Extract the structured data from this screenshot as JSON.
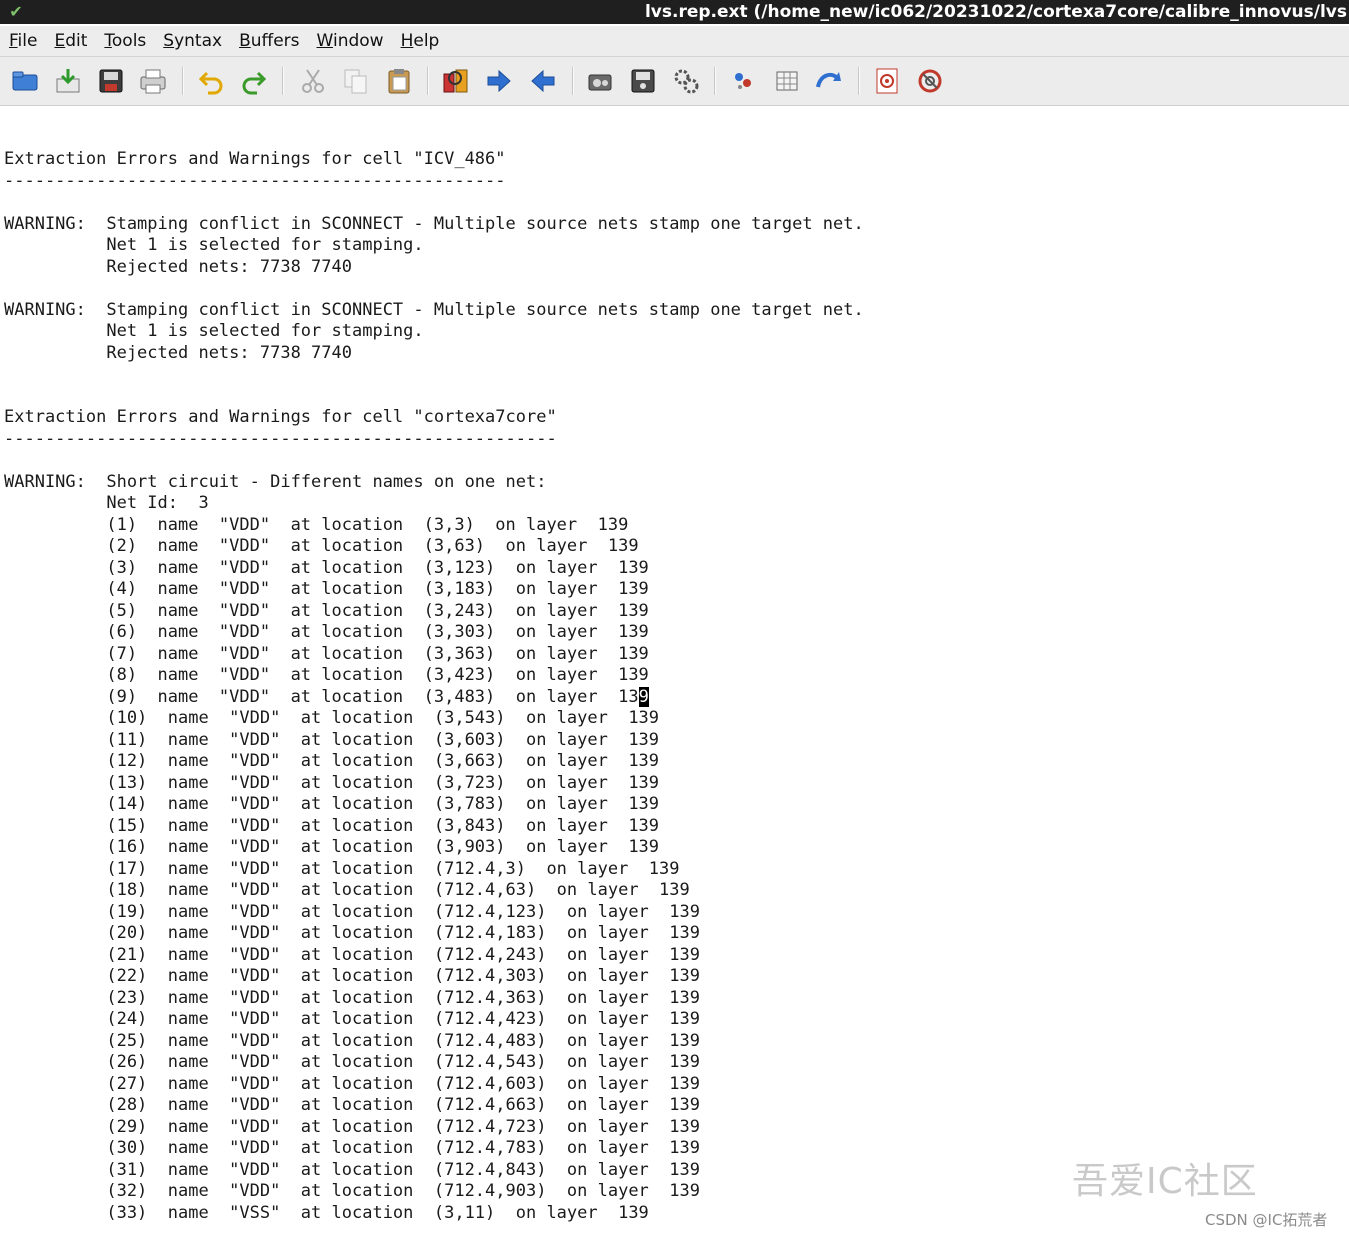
{
  "window": {
    "title": "lvs.rep.ext (/home_new/ic062/20231022/cortexa7core/calibre_innovus/lvs",
    "icon": "vim-icon"
  },
  "menu": [
    "File",
    "Edit",
    "Tools",
    "Syntax",
    "Buffers",
    "Window",
    "Help"
  ],
  "toolbar": {
    "icons": [
      "open-icon",
      "save-icon",
      "save-all-icon",
      "print-icon",
      "undo-icon",
      "redo-icon",
      "cut-icon",
      "copy-icon",
      "paste-icon",
      "find-replace-icon",
      "find-next-icon",
      "find-prev-icon",
      "load-session-icon",
      "save-session-icon",
      "run-script-icon",
      "make-icon",
      "shell-icon",
      "ctags-jump-icon",
      "help-icon",
      "find-help-icon"
    ],
    "accent_blue": "#2f6fd0",
    "accent_green": "#3a9a2a",
    "accent_yellow": "#e6b400",
    "accent_red": "#c0392b"
  },
  "editor": {
    "cursor": {
      "line": 27,
      "col": 16
    },
    "lines": [
      "",
      "",
      "Extraction Errors and Warnings for cell \"ICV_486\"",
      "-------------------------------------------------",
      "",
      "WARNING:  Stamping conflict in SCONNECT - Multiple source nets stamp one target net.",
      "          Net 1 is selected for stamping.",
      "          Rejected nets: 7738 7740",
      "",
      "WARNING:  Stamping conflict in SCONNECT - Multiple source nets stamp one target net.",
      "          Net 1 is selected for stamping.",
      "          Rejected nets: 7738 7740",
      "",
      "",
      "Extraction Errors and Warnings for cell \"cortexa7core\"",
      "------------------------------------------------------",
      "",
      "WARNING:  Short circuit - Different names on one net:",
      "          Net Id:  3",
      "          (1)  name  \"VDD\"  at location  (3,3)  on layer  139",
      "          (2)  name  \"VDD\"  at location  (3,63)  on layer  139",
      "          (3)  name  \"VDD\"  at location  (3,123)  on layer  139",
      "          (4)  name  \"VDD\"  at location  (3,183)  on layer  139",
      "          (5)  name  \"VDD\"  at location  (3,243)  on layer  139",
      "          (6)  name  \"VDD\"  at location  (3,303)  on layer  139",
      "          (7)  name  \"VDD\"  at location  (3,363)  on layer  139",
      "          (8)  name  \"VDD\"  at location  (3,423)  on layer  139",
      "          (9)  name  \"VDD\"  at location  (3,483)  on layer  139",
      "          (10)  name  \"VDD\"  at location  (3,543)  on layer  139",
      "          (11)  name  \"VDD\"  at location  (3,603)  on layer  139",
      "          (12)  name  \"VDD\"  at location  (3,663)  on layer  139",
      "          (13)  name  \"VDD\"  at location  (3,723)  on layer  139",
      "          (14)  name  \"VDD\"  at location  (3,783)  on layer  139",
      "          (15)  name  \"VDD\"  at location  (3,843)  on layer  139",
      "          (16)  name  \"VDD\"  at location  (3,903)  on layer  139",
      "          (17)  name  \"VDD\"  at location  (712.4,3)  on layer  139",
      "          (18)  name  \"VDD\"  at location  (712.4,63)  on layer  139",
      "          (19)  name  \"VDD\"  at location  (712.4,123)  on layer  139",
      "          (20)  name  \"VDD\"  at location  (712.4,183)  on layer  139",
      "          (21)  name  \"VDD\"  at location  (712.4,243)  on layer  139",
      "          (22)  name  \"VDD\"  at location  (712.4,303)  on layer  139",
      "          (23)  name  \"VDD\"  at location  (712.4,363)  on layer  139",
      "          (24)  name  \"VDD\"  at location  (712.4,423)  on layer  139",
      "          (25)  name  \"VDD\"  at location  (712.4,483)  on layer  139",
      "          (26)  name  \"VDD\"  at location  (712.4,543)  on layer  139",
      "          (27)  name  \"VDD\"  at location  (712.4,603)  on layer  139",
      "          (28)  name  \"VDD\"  at location  (712.4,663)  on layer  139",
      "          (29)  name  \"VDD\"  at location  (712.4,723)  on layer  139",
      "          (30)  name  \"VDD\"  at location  (712.4,783)  on layer  139",
      "          (31)  name  \"VDD\"  at location  (712.4,843)  on layer  139",
      "          (32)  name  \"VDD\"  at location  (712.4,903)  on layer  139",
      "          (33)  name  \"VSS\"  at location  (3,11)  on layer  139"
    ]
  },
  "watermark": "吾爱IC社区",
  "credit": "CSDN @IC拓荒者"
}
